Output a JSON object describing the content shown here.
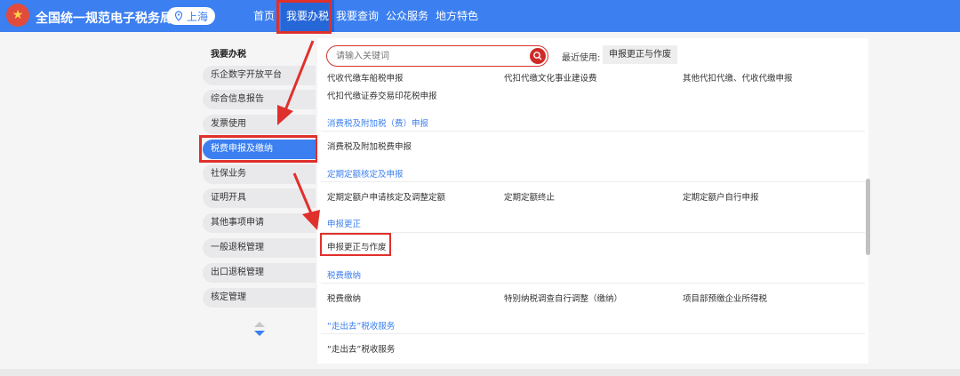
{
  "header": {
    "site_title": "全国统一规范电子税务局",
    "region": "上海",
    "nav": [
      {
        "label": "首页"
      },
      {
        "label": "我要办税"
      },
      {
        "label": "我要查询"
      },
      {
        "label": "公众服务"
      },
      {
        "label": "地方特色"
      }
    ],
    "accent": "#3b7ff0"
  },
  "sidebar": {
    "heading": "我要办税",
    "items": [
      {
        "label": "乐企数字开放平台"
      },
      {
        "label": "综合信息报告"
      },
      {
        "label": "发票使用"
      },
      {
        "label": "税费申报及缴纳"
      },
      {
        "label": "社保业务"
      },
      {
        "label": "证明开具"
      },
      {
        "label": "其他事项申请"
      },
      {
        "label": "一般退税管理"
      },
      {
        "label": "出口退税管理"
      },
      {
        "label": "核定管理"
      }
    ]
  },
  "search": {
    "placeholder": "请输入关键词",
    "recent_label": "最近使用:",
    "recent_item": "申报更正与作废"
  },
  "content": {
    "top_rows": [
      [
        "代收代缴车船税申报",
        "代扣代缴文化事业建设费",
        "其他代扣代缴、代收代缴申报"
      ],
      [
        "代扣代缴证券交易印花税申报"
      ]
    ],
    "sections": [
      {
        "title": "消费税及附加税（费）申报",
        "items": [
          "消费税及附加税费申报"
        ]
      },
      {
        "title": "定期定额核定及申报",
        "items": [
          "定期定额户申请核定及调整定额",
          "定期定额终止",
          "定期定额户自行申报"
        ]
      },
      {
        "title": "申报更正",
        "items": [
          "申报更正与作废"
        ]
      },
      {
        "title": "税费缴纳",
        "items": [
          "税费缴纳",
          "特别纳税调查自行调整（缴纳）",
          "项目部预缴企业所得税"
        ]
      },
      {
        "title": "“走出去”税收服务",
        "items": [
          "“走出去”税收服务"
        ]
      }
    ]
  },
  "colors": {
    "highlight": "#e0302c",
    "section_title": "#3b7ff0"
  }
}
